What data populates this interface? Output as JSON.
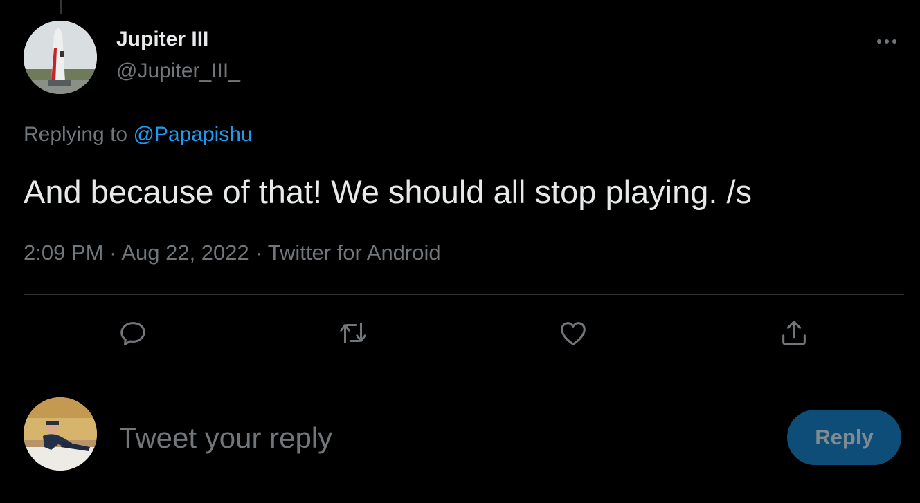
{
  "author": {
    "display_name": "Jupiter III",
    "handle": "@Jupiter_III_"
  },
  "reply_context": {
    "prefix": "Replying to",
    "mention": "@Papapishu"
  },
  "tweet": {
    "text": "And because of that! We should all stop playing. /s",
    "time": "2:09 PM",
    "date": "Aug 22, 2022",
    "source": "Twitter for Android",
    "separator": "·"
  },
  "actions": [
    {
      "name": "reply",
      "icon": "reply-icon"
    },
    {
      "name": "retweet",
      "icon": "retweet-icon"
    },
    {
      "name": "like",
      "icon": "heart-icon"
    },
    {
      "name": "share",
      "icon": "share-icon"
    }
  ],
  "composer": {
    "placeholder": "Tweet your reply",
    "button_label": "Reply"
  },
  "colors": {
    "background": "#000000",
    "text": "#e7e9ea",
    "muted": "#71767b",
    "link": "#1d9bf0",
    "reply_button": "#0e4d78"
  }
}
